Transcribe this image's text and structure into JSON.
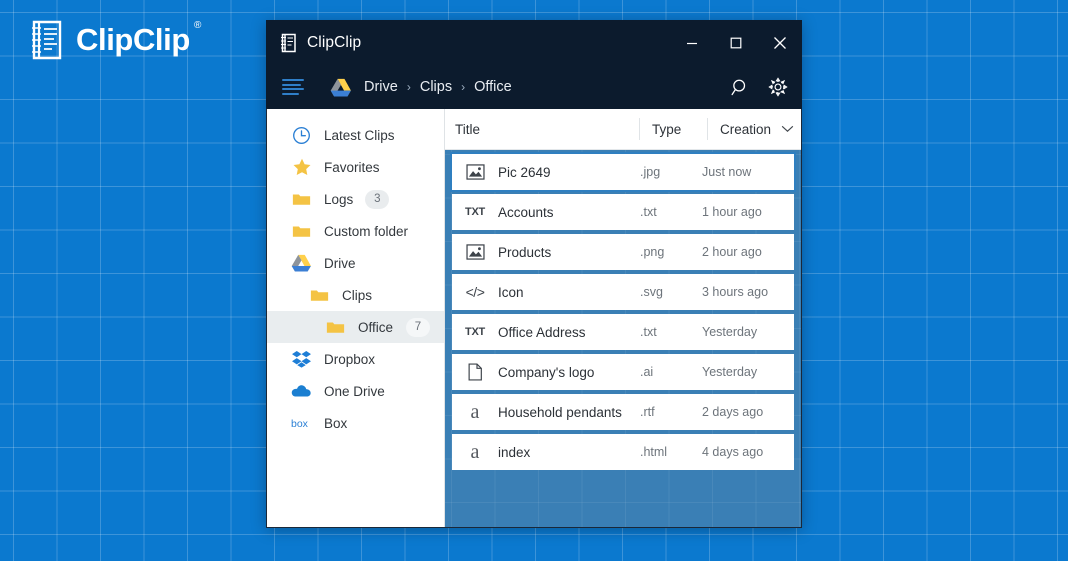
{
  "brand": {
    "name": "ClipClip",
    "registered_mark": "®",
    "logo_icon": "clipclip-logo-icon"
  },
  "window": {
    "title": "ClipClip",
    "app_icon": "clipclip-app-icon",
    "controls": {
      "minimize": "—",
      "maximize": "□",
      "close": "✕"
    }
  },
  "toolbar": {
    "menu_icon": "hamburger-menu-icon",
    "drive_icon": "google-drive-icon",
    "breadcrumb": [
      "Drive",
      "Clips",
      "Office"
    ],
    "separator": "›",
    "search_icon": "search-icon",
    "settings_icon": "gear-icon"
  },
  "sidebar": {
    "items": [
      {
        "label": "Latest Clips",
        "icon": "clock-icon",
        "indent": 0,
        "badge": null,
        "selected": false
      },
      {
        "label": "Favorites",
        "icon": "star-icon",
        "indent": 0,
        "badge": null,
        "selected": false
      },
      {
        "label": "Logs",
        "icon": "folder-icon",
        "indent": 0,
        "badge": "3",
        "selected": false
      },
      {
        "label": "Custom folder",
        "icon": "folder-icon",
        "indent": 0,
        "badge": null,
        "selected": false
      },
      {
        "label": "Drive",
        "icon": "google-drive-icon",
        "indent": 0,
        "badge": null,
        "selected": false
      },
      {
        "label": "Clips",
        "icon": "folder-icon",
        "indent": 1,
        "badge": null,
        "selected": false
      },
      {
        "label": "Office",
        "icon": "folder-icon",
        "indent": 2,
        "badge": "7",
        "selected": true
      },
      {
        "label": "Dropbox",
        "icon": "dropbox-icon",
        "indent": 0,
        "badge": null,
        "selected": false
      },
      {
        "label": "One Drive",
        "icon": "onedrive-icon",
        "indent": 0,
        "badge": null,
        "selected": false
      },
      {
        "label": "Box",
        "icon": "box-icon",
        "indent": 0,
        "badge": null,
        "selected": false
      }
    ]
  },
  "list": {
    "columns": {
      "title": "Title",
      "type": "Type",
      "creation": "Creation",
      "sort_icon": "chevron-down-icon"
    },
    "rows": [
      {
        "icon": "image-file-icon",
        "title": "Pic 2649",
        "type": ".jpg",
        "creation": "Just now",
        "selected": true
      },
      {
        "icon": "txt-file-icon",
        "title": "Accounts",
        "type": ".txt",
        "creation": "1 hour ago",
        "selected": false
      },
      {
        "icon": "image-file-icon",
        "title": "Products",
        "type": ".png",
        "creation": "2 hour ago",
        "selected": false
      },
      {
        "icon": "code-file-icon",
        "title": "Icon",
        "type": ".svg",
        "creation": "3 hours ago",
        "selected": false
      },
      {
        "icon": "txt-file-icon",
        "title": "Office Address",
        "type": ".txt",
        "creation": "Yesterday",
        "selected": false
      },
      {
        "icon": "document-file-icon",
        "title": "Company's logo",
        "type": ".ai",
        "creation": "Yesterday",
        "selected": false
      },
      {
        "icon": "font-file-icon",
        "title": "Household pendants",
        "type": ".rtf",
        "creation": "2 days ago",
        "selected": false
      },
      {
        "icon": "font-file-icon",
        "title": "index",
        "type": ".html",
        "creation": "4 days ago",
        "selected": false
      }
    ]
  },
  "colors": {
    "page_background": "#0b79cf",
    "titlebar": "#0c1b2d",
    "list_background": "#3a7fb5",
    "selection_border": "#2f7fc0",
    "sidebar_selected": "#e9edef",
    "folder_yellow": "#f4c344",
    "drive_yellow": "#ffd04b",
    "drive_blue": "#3b7fd4",
    "dropbox_blue": "#1e7ed6",
    "onedrive_blue": "#1b7fd1",
    "box_blue": "#2a7fd4"
  }
}
